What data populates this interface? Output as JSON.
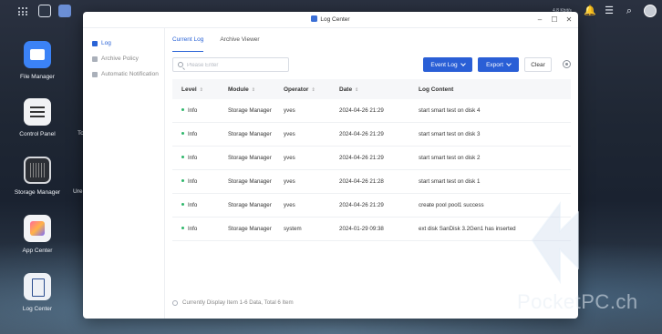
{
  "desktop": {
    "icons": [
      {
        "label": "File Manager"
      },
      {
        "label": "Control Panel"
      },
      {
        "label": "Storage Manager"
      },
      {
        "label": "App Center"
      },
      {
        "label": "Log Center"
      }
    ],
    "peek_labels": [
      "To",
      "Ure"
    ]
  },
  "tray": {
    "info_text": "4.8 Kbit/s"
  },
  "window": {
    "title": "Log Center",
    "controls": {
      "minimize": "–",
      "maximize": "☐",
      "close": "✕"
    }
  },
  "sidebar": {
    "items": [
      {
        "label": "Log",
        "active": true
      },
      {
        "label": "Archive Policy",
        "active": false
      },
      {
        "label": "Automatic Notification",
        "active": false
      }
    ]
  },
  "tabs": [
    {
      "label": "Current Log",
      "active": true
    },
    {
      "label": "Archive Viewer",
      "active": false
    }
  ],
  "toolbar": {
    "search_placeholder": "Please Enter",
    "search_value": "",
    "event_log_label": "Event Log",
    "export_label": "Export",
    "clear_label": "Clear"
  },
  "table": {
    "headers": [
      "Level",
      "Module",
      "Operator",
      "Date",
      "Log Content"
    ],
    "rows": [
      {
        "level": "Info",
        "module": "Storage Manager",
        "operator": "yves",
        "date": "2024-04-26 21:29",
        "content": "start smart test on disk 4"
      },
      {
        "level": "Info",
        "module": "Storage Manager",
        "operator": "yves",
        "date": "2024-04-26 21:29",
        "content": "start smart test on disk 3"
      },
      {
        "level": "Info",
        "module": "Storage Manager",
        "operator": "yves",
        "date": "2024-04-26 21:29",
        "content": "start smart test on disk 2"
      },
      {
        "level": "Info",
        "module": "Storage Manager",
        "operator": "yves",
        "date": "2024-04-26 21:28",
        "content": "start smart test on disk 1"
      },
      {
        "level": "Info",
        "module": "Storage Manager",
        "operator": "yves",
        "date": "2024-04-26 21:29",
        "content": "create pool pool1 success"
      },
      {
        "level": "Info",
        "module": "Storage Manager",
        "operator": "system",
        "date": "2024-01-29 09:38",
        "content": "ext disk SanDisk 3.2Gen1 has inserted"
      }
    ]
  },
  "footer": {
    "status": "Currently Display Item 1-6 Data, Total 6 Item"
  },
  "watermark": {
    "text": "PocketPC.ch"
  },
  "colors": {
    "accent": "#2a5fd6",
    "info_dot": "#2fb76b"
  }
}
